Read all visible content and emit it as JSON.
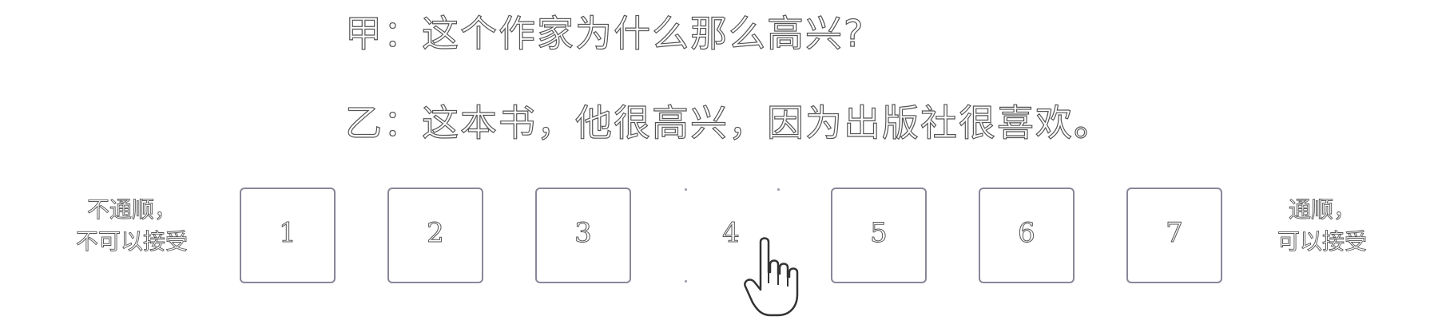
{
  "dialogue": {
    "line_a": "甲：这个作家为什么那么高兴?",
    "line_b": "乙：这本书，他很高兴，因为出版社很喜欢。"
  },
  "scale": {
    "left_label_line1": "不通顺，",
    "left_label_line2": "不可以接受",
    "right_label_line1": "通顺，",
    "right_label_line2": "可以接受",
    "options": [
      "1",
      "2",
      "3",
      "4",
      "5",
      "6",
      "7"
    ],
    "hovered_option": "4"
  },
  "icons": {
    "cursor": "hand-pointer-icon"
  },
  "colors": {
    "box_border": "#8a8699",
    "text_outline": "#555555"
  }
}
